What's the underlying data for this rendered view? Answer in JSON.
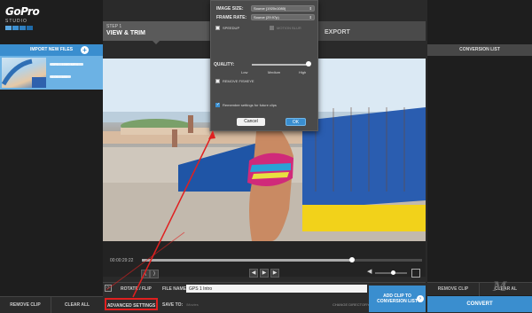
{
  "app": {
    "logo_name": "GoPro",
    "logo_sub": "STUDIO"
  },
  "left_panel": {
    "import_label": "IMPORT NEW FILES",
    "clip": {
      "name": "GP1 - 1080 MP4",
      "detail": "0.09 / 180"
    },
    "remove_clip": "REMOVE CLIP",
    "clear_all": "CLEAR ALL"
  },
  "steps": {
    "step1_small": "STEP 1",
    "step1_big": "VIEW & TRIM",
    "step3_big": "EXPORT"
  },
  "player": {
    "timecode": "00:00:29:22",
    "progress": 0.75,
    "volume": 0.55
  },
  "bottom": {
    "rotate_label": "ROTATE / FLIP",
    "file_name_label": "FILE NAME:",
    "file_name_value": "GPS 1 Intro",
    "advanced_settings": "ADVANCED SETTINGS",
    "save_to_label": "SAVE TO:",
    "save_to_path": "/Movies",
    "change_directory": "CHANGE DIRECTORY",
    "add_clip_line1": "ADD CLIP TO",
    "add_clip_line2": "CONVERSION LIST"
  },
  "right_panel": {
    "conversion_list_label": "CONVERSION LIST",
    "remove_clip": "REMOVE CLIP",
    "clear_all": "CLEAR AL",
    "convert": "CONVERT",
    "watermark": "M"
  },
  "dialog": {
    "image_size_label": "IMAGE SIZE:",
    "image_size_value": "Source (1920x1080)",
    "frame_rate_label": "FRAME RATE:",
    "frame_rate_value": "Source (29.97p)",
    "speedup_label": "SPEEDUP",
    "motion_blur_label": "MOTION BLUR",
    "quality_label": "QUALITY:",
    "quality_low": "Low",
    "quality_medium": "Medium",
    "quality_high": "High",
    "remove_fisheye_label": "REMOVE FISHEYE",
    "remember_label": "Remember settings for future clips",
    "cancel": "Cancel",
    "ok": "OK"
  },
  "colors": {
    "accent": "#3a8ecf",
    "annotation": "#e02020"
  }
}
